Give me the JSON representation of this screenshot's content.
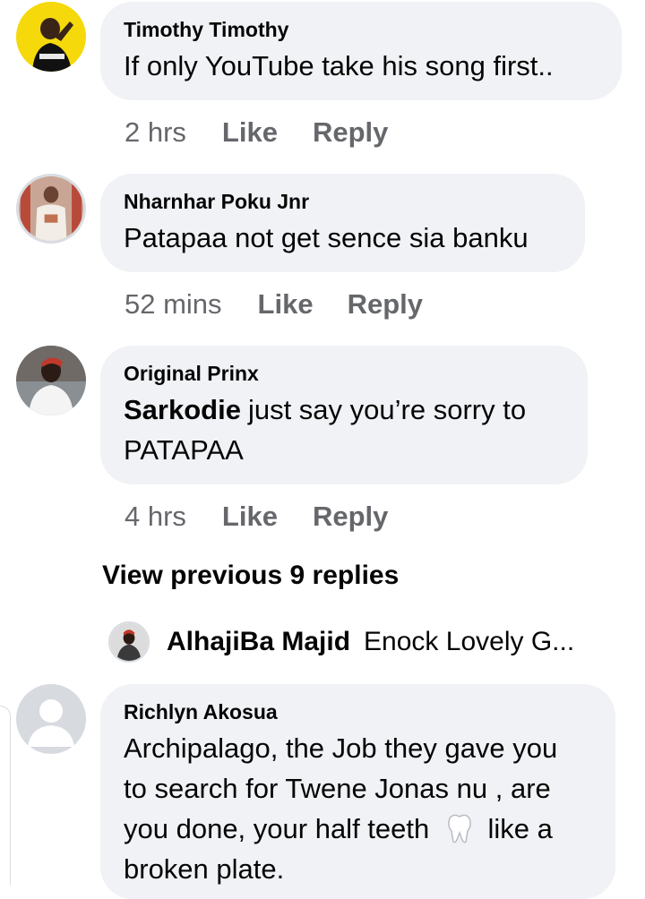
{
  "comments": [
    {
      "author": "Timothy Timothy",
      "text": "If only YouTube take his song first..",
      "time": "2 hrs",
      "like": "Like",
      "reply": "Reply",
      "avatar_icon": "user-photo-avatar"
    },
    {
      "author": "Nharnhar Poku Jnr",
      "text": "Patapaa not get sence sia banku",
      "time": "52 mins",
      "like": "Like",
      "reply": "Reply",
      "avatar_icon": "user-photo-avatar"
    },
    {
      "author": "Original Prinx",
      "mention": "Sarkodie",
      "text_line1": "just say you’re sorry to",
      "text_line2": "PATAPAA",
      "time": "4 hrs",
      "like": "Like",
      "reply": "Reply",
      "avatar_icon": "user-photo-avatar"
    }
  ],
  "view_previous": "View previous 9 replies",
  "reply_preview": {
    "author": "AlhajiBa Majid",
    "text": "Enock Lovely G...",
    "avatar_icon": "user-photo-avatar"
  },
  "last_comment": {
    "author": "Richlyn Akosua",
    "line1": "Archipalago, the Job they gave you",
    "line2": "to search for Twene Jonas nu , are",
    "line3_a": "you done, your half teeth",
    "line3_b": "like a",
    "line4": "broken plate.",
    "emoji_icon": "tooth-emoji-icon",
    "avatar_icon": "default-avatar-icon"
  },
  "colors": {
    "bubble": "#f0f2f5",
    "meta_text": "#65676b",
    "primary_text": "#050505",
    "avatar1_bg": "#f5d90a"
  }
}
